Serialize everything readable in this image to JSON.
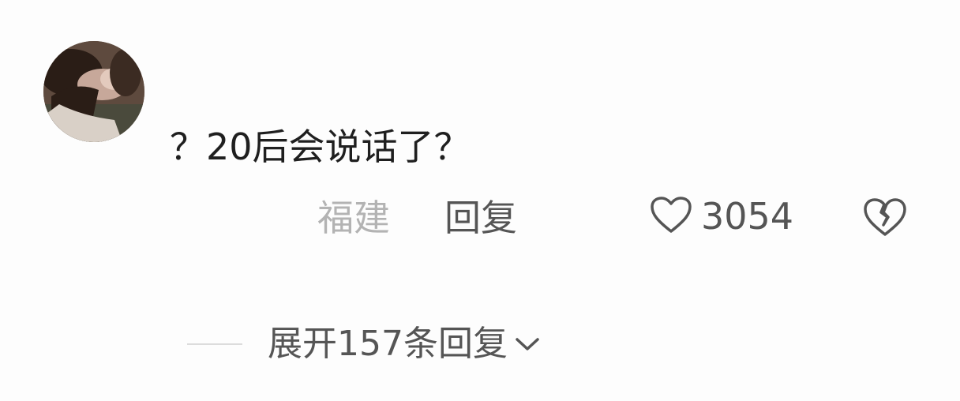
{
  "comment": {
    "avatar_icon": "user-avatar-photo",
    "text": "？20后会说话了？",
    "location": "福建",
    "reply_label": "回复",
    "like_icon": "heart-outline-icon",
    "like_count": "3054",
    "dislike_icon": "broken-heart-icon"
  },
  "replies": {
    "expand_label": "展开157条回复",
    "chevron_icon": "chevron-down-icon"
  },
  "colors": {
    "text_primary": "#1f1f1f",
    "text_secondary": "#555555",
    "text_muted": "#b3b3b3",
    "background": "#fdfdfd"
  }
}
